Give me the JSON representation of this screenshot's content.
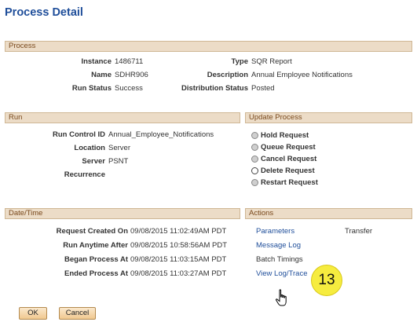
{
  "page": {
    "title": "Process Detail"
  },
  "process": {
    "header": "Process",
    "instance_label": "Instance",
    "instance_value": "1486711",
    "name_label": "Name",
    "name_value": "SDHR906",
    "run_status_label": "Run Status",
    "run_status_value": "Success",
    "type_label": "Type",
    "type_value": "SQR Report",
    "description_label": "Description",
    "description_value": "Annual Employee Notifications",
    "distribution_status_label": "Distribution Status",
    "distribution_status_value": "Posted"
  },
  "run": {
    "header": "Run",
    "run_control_id_label": "Run Control ID",
    "run_control_id_value": "Annual_Employee_Notifications",
    "location_label": "Location",
    "location_value": "Server",
    "server_label": "Server",
    "server_value": "PSNT",
    "recurrence_label": "Recurrence"
  },
  "update_process": {
    "header": "Update Process",
    "options": [
      "Hold Request",
      "Queue Request",
      "Cancel Request",
      "Delete Request",
      "Restart Request"
    ]
  },
  "datetime": {
    "header": "Date/Time",
    "request_created_label": "Request Created On",
    "request_created_value": "09/08/2015 11:02:49AM PDT",
    "run_anytime_label": "Run Anytime After",
    "run_anytime_value": "09/08/2015 10:58:56AM PDT",
    "began_label": "Began Process At",
    "began_value": "09/08/2015 11:03:15AM PDT",
    "ended_label": "Ended Process At",
    "ended_value": "09/08/2015 11:03:27AM PDT"
  },
  "actions": {
    "header": "Actions",
    "parameters": "Parameters",
    "transfer": "Transfer",
    "message_log": "Message Log",
    "batch_timings": "Batch Timings",
    "view_log_trace": "View Log/Trace"
  },
  "buttons": {
    "ok": "OK",
    "cancel": "Cancel"
  },
  "callout": {
    "number": "13"
  }
}
